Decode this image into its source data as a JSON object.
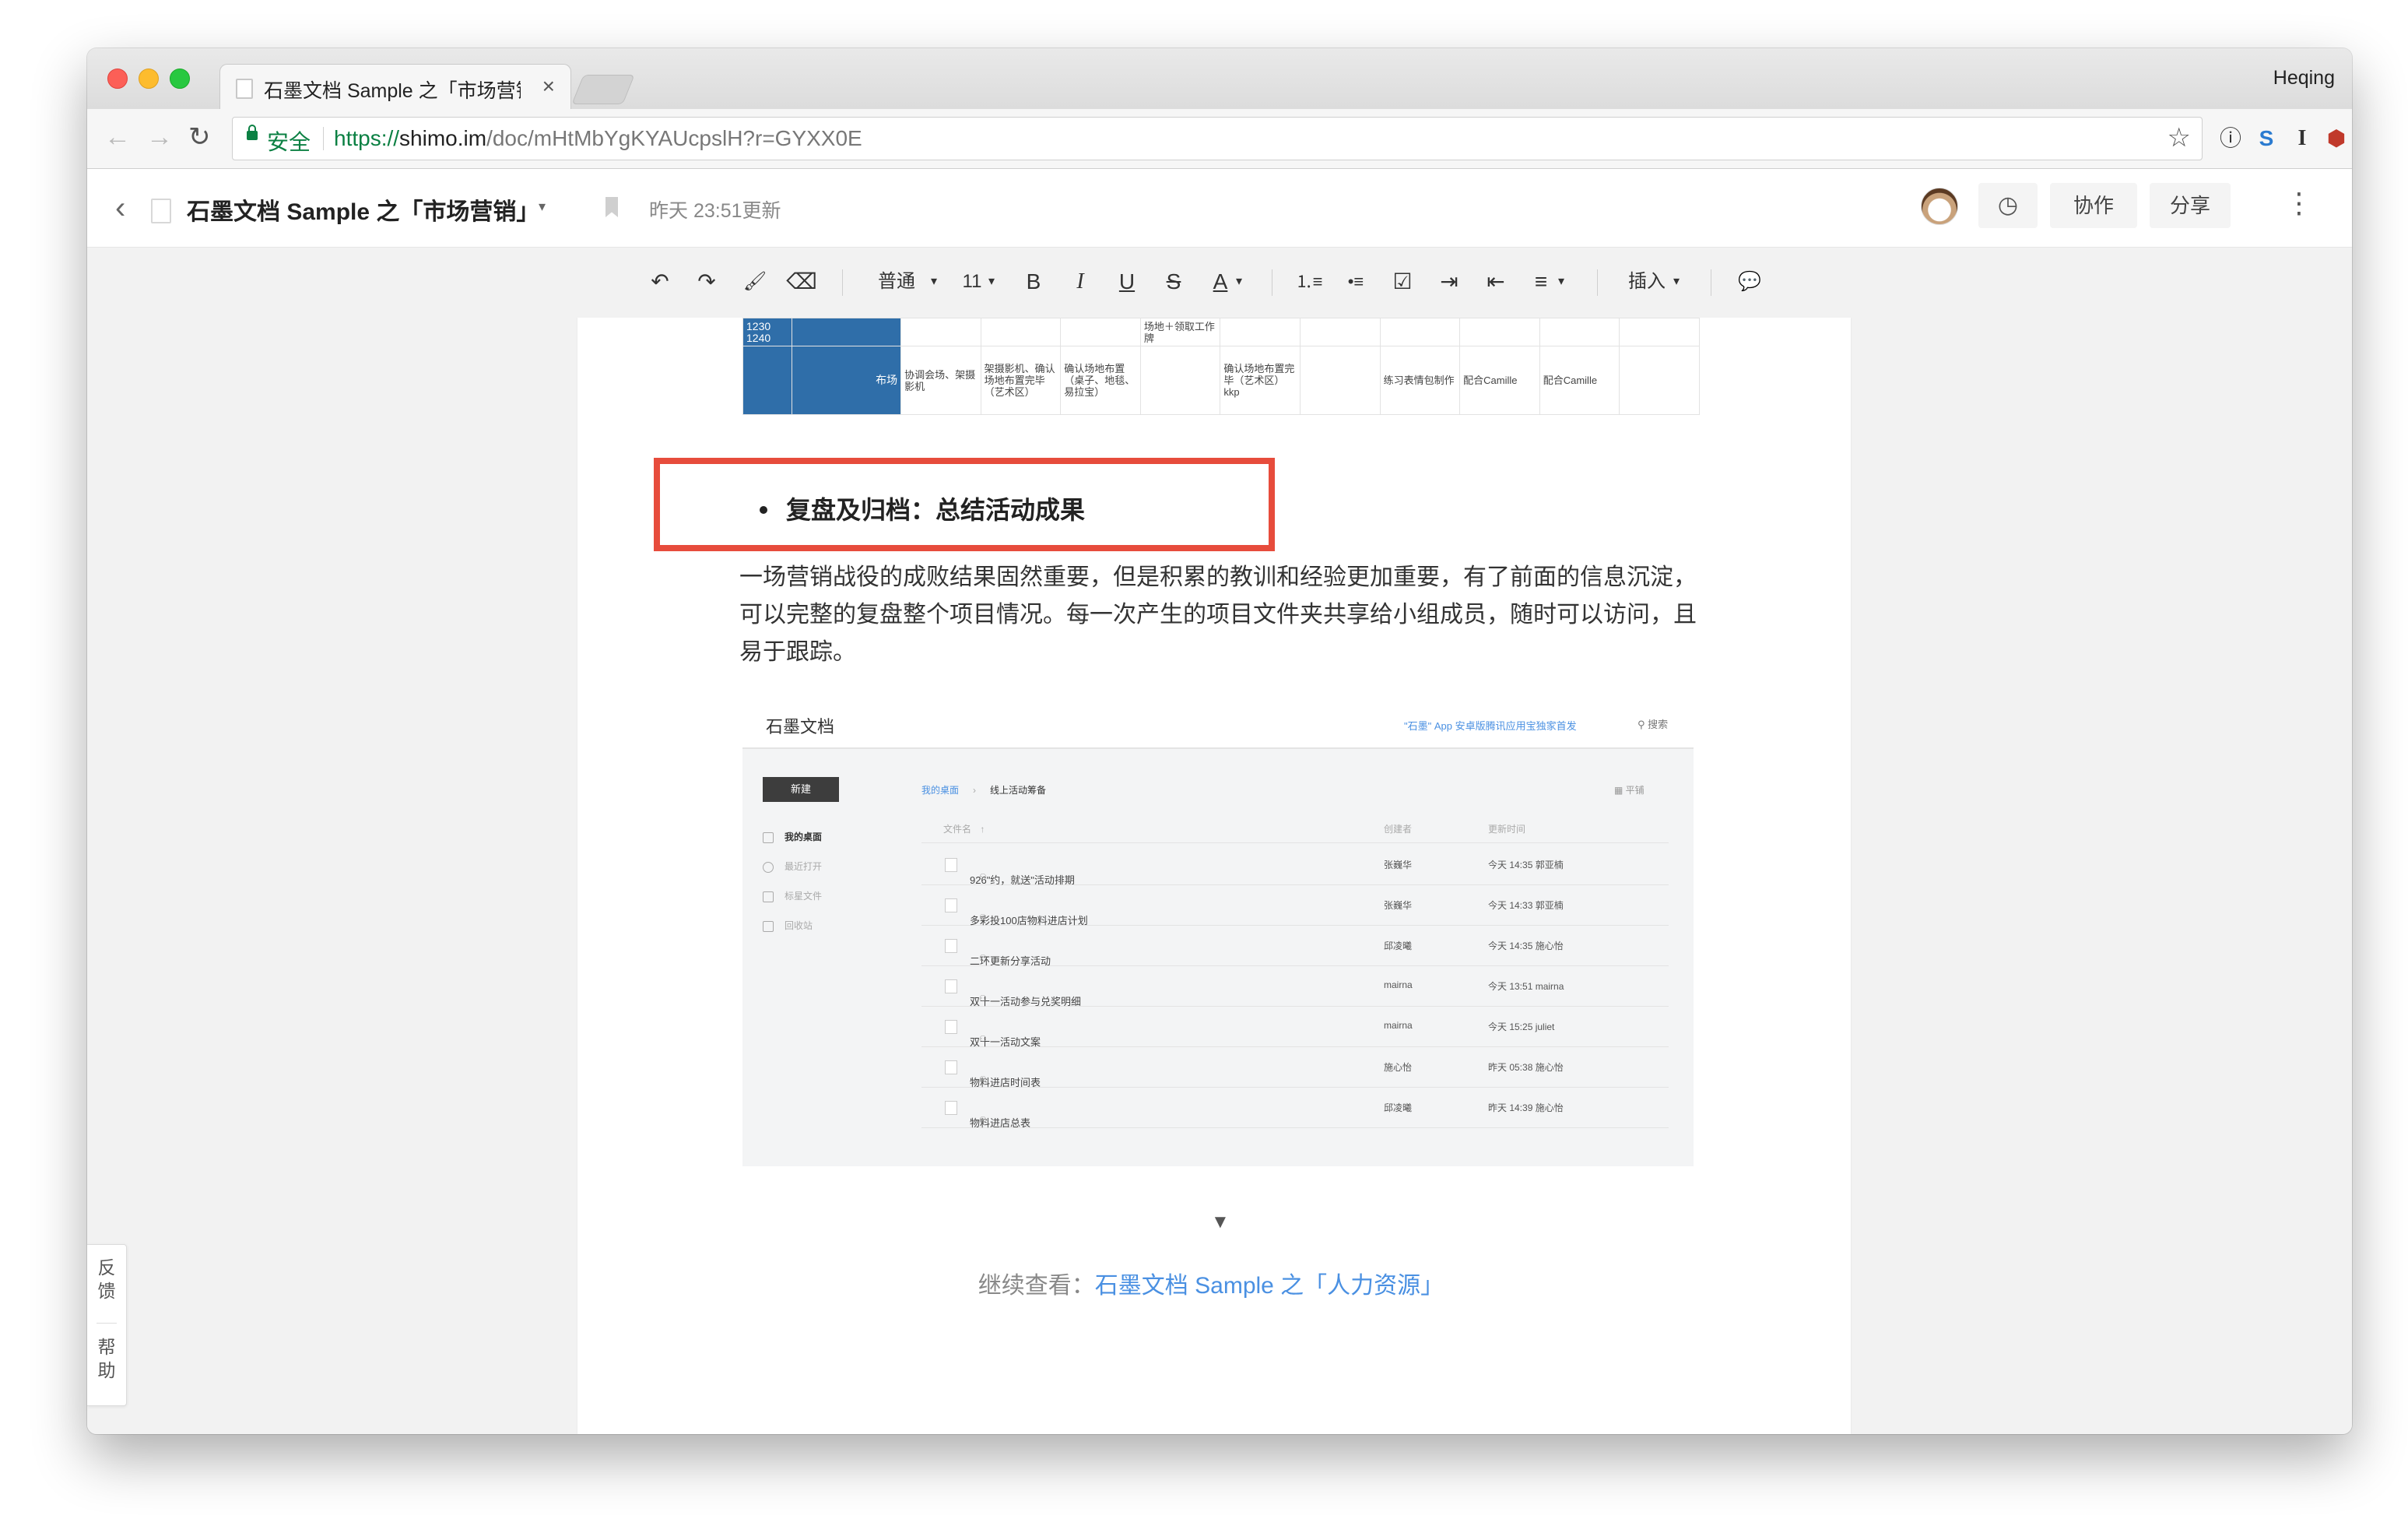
{
  "browser": {
    "tab_title": "石墨文档 Sample 之「市场营销」",
    "tab_close": "×",
    "profile_name": "Heqing",
    "secure_label": "安全",
    "url_scheme": "https://",
    "url_host": "shimo.im",
    "url_path": "/doc/mHtMbYgKYAUcpslH?r=GYXX0E",
    "nav": {
      "back": "←",
      "forward": "→",
      "reload": "↻"
    },
    "star": "☆",
    "extensions": [
      "ⓘ",
      "S",
      "I",
      "⬢",
      "⋮"
    ]
  },
  "doc_header": {
    "back": "‹",
    "title": "石墨文档 Sample 之「市场营销」",
    "title_caret": "▾",
    "updated": "昨天 23:51更新",
    "history_icon": "◷",
    "collaborate_label": "协作",
    "share_label": "分享",
    "more": "⋮"
  },
  "format_toolbar": {
    "undo": "↶",
    "redo": "↷",
    "paint_format": "🖌",
    "clear_format": "⌫",
    "style": "普通",
    "font_size": "11",
    "bold": "B",
    "italic": "I",
    "underline": "U",
    "strike": "S",
    "font_color": "A",
    "dropdown_caret": "▾",
    "ordered_list": "⒈≡",
    "unordered_list": "•≡",
    "checklist": "☑",
    "indent": "⇥",
    "outdent": "⇤",
    "align": "≡",
    "insert_label": "插入",
    "comment": "💬"
  },
  "schedule_table": {
    "top_left_cell": "1230   1240",
    "top_row_cell": "场地＋领取工作牌",
    "row_label": "布场",
    "cells": [
      "协调会场、架摄影机",
      "架摄影机、确认场地布置完毕（艺术区）",
      "确认场地布置（桌子、地毯、易拉宝）",
      "",
      "确认场地布置完毕（艺术区）kkp",
      "",
      "练习表情包制作",
      "配合Camille",
      "配合Camille",
      ""
    ]
  },
  "section": {
    "bullet_heading": "复盘及归档：总结活动成果",
    "paragraph": "一场营销战役的成败结果固然重要，但是积累的教训和经验更加重要，有了前面的信息沉淀，可以完整的复盘整个项目情况。每一次产生的项目文件夹共享给小组成员，随时可以访问，且易于跟踪。"
  },
  "embedded_screenshot": {
    "logo": "石墨文档",
    "promo": "\"石墨\" App 安卓版腾讯应用宝独家首发",
    "search": "搜索",
    "new_button": "新建",
    "nav": [
      "我的桌面",
      "最近打开",
      "标星文件",
      "回收站"
    ],
    "breadcrumb": [
      "我的桌面",
      "线上活动筹备"
    ],
    "breadcrumb_sep": "›",
    "view_toggle": "平铺",
    "headers": {
      "name": "文件名",
      "sort": "↑",
      "creator": "创建者",
      "updated": "更新时间"
    },
    "files": [
      {
        "name": "926\"约，就送\"活动排期",
        "creator": "张巍华",
        "updated": "今天 14:35  郭亚楠"
      },
      {
        "name": "多彩投100店物料进店计划",
        "creator": "张巍华",
        "updated": "今天 14:33  郭亚楠"
      },
      {
        "name": "二环更新分享活动",
        "creator": "邱凌曦",
        "updated": "今天 14:35  施心怡"
      },
      {
        "name": "双十一活动参与兑奖明细",
        "creator": "mairna",
        "updated": "今天 13:51  mairna"
      },
      {
        "name": "双十一活动文案",
        "creator": "mairna",
        "updated": "今天 15:25  juliet"
      },
      {
        "name": "物料进店时间表",
        "creator": "施心怡",
        "updated": "昨天 05:38  施心怡"
      },
      {
        "name": "物料进店总表",
        "creator": "邱凌曦",
        "updated": "昨天 14:39  施心怡"
      }
    ],
    "coop_glyph": "⚇"
  },
  "footer": {
    "arrow": "▼",
    "continue_prefix": "继续查看：",
    "continue_link": "石墨文档 Sample 之「人力资源」"
  },
  "side_tab": {
    "feedback": "反馈",
    "help": "帮助"
  },
  "colors": {
    "highlight_border": "#e74c3c",
    "link": "#4a90e2",
    "table_blue": "#2f6ea9",
    "secure_green": "#0b8043"
  }
}
